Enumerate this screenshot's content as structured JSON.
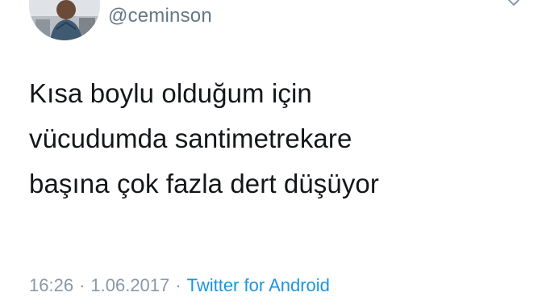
{
  "tweet": {
    "display_name": "",
    "handle": "@ceminson",
    "text_lines": [
      "Kısa boylu olduğum için",
      "vücudumda santimetrekare",
      "başına çok fazla dert düşüyor"
    ],
    "time": "16:26",
    "separator": "·",
    "date": "1.06.2017",
    "source": "Twitter for Android"
  },
  "icons": {
    "avatar": "profile-photo",
    "menu": "chevron-down-icon"
  },
  "colors": {
    "text": "#14171a",
    "handle": "#657786",
    "meta": "#8899a6",
    "link": "#1b95e0",
    "background": "#ffffff"
  }
}
